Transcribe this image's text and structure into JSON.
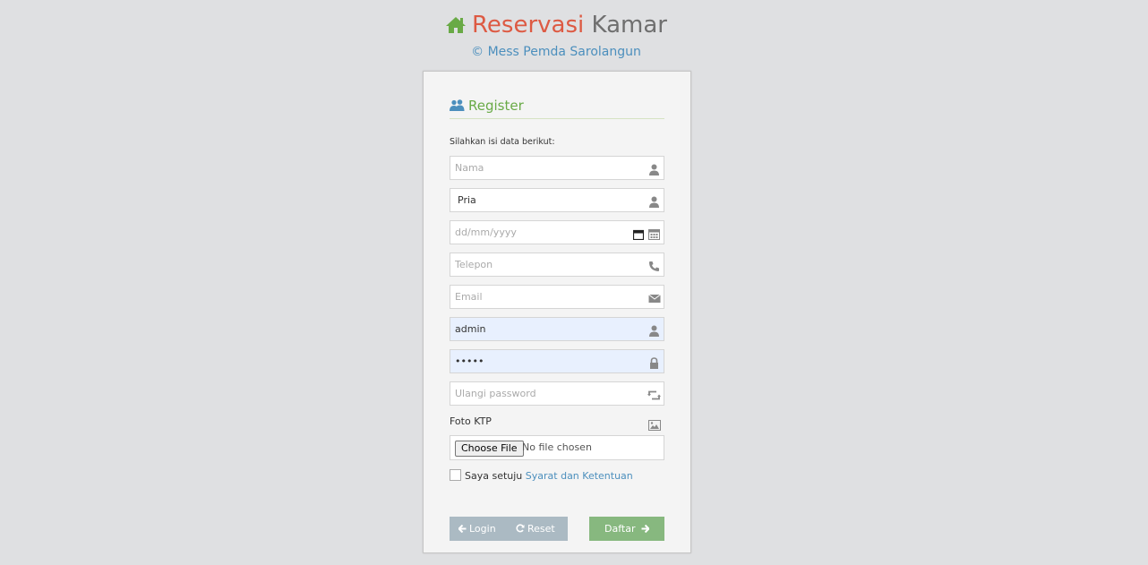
{
  "header": {
    "title_part1": "Reservasi",
    "title_part2": "Kamar",
    "subtitle": "© Mess Pemda Sarolangun"
  },
  "form": {
    "heading": "Register",
    "intro": "Silahkan isi data berikut:",
    "fields": {
      "nama": {
        "placeholder": "Nama",
        "value": ""
      },
      "gender": {
        "value": "Pria"
      },
      "tanggal": {
        "placeholder": "dd/mm/yyyy"
      },
      "telepon": {
        "placeholder": "Telepon",
        "value": ""
      },
      "email": {
        "placeholder": "Email",
        "value": ""
      },
      "username": {
        "value": "admin"
      },
      "password": {
        "value": "•••••"
      },
      "ulangi": {
        "placeholder": "Ulangi password",
        "value": ""
      }
    },
    "foto_label": "Foto KTP",
    "file_button": "Choose File",
    "file_status": "No file chosen",
    "agree_text": "Saya setuju",
    "agree_link": "Syarat dan Ketentuan",
    "buttons": {
      "login": "Login",
      "reset": "Reset",
      "daftar": "Daftar"
    }
  },
  "colors": {
    "brand_red": "#dd5a43",
    "brand_green": "#69aa46",
    "link_blue": "#4c8fbd",
    "btn_gray": "#abbac3",
    "btn_green": "#87b87f"
  },
  "icons": [
    "home-icon",
    "users-icon",
    "user-icon",
    "calendar-icon",
    "phone-icon",
    "envelope-icon",
    "lock-icon",
    "retweet-icon",
    "picture-icon",
    "arrow-left-icon",
    "refresh-icon",
    "arrow-right-icon"
  ]
}
